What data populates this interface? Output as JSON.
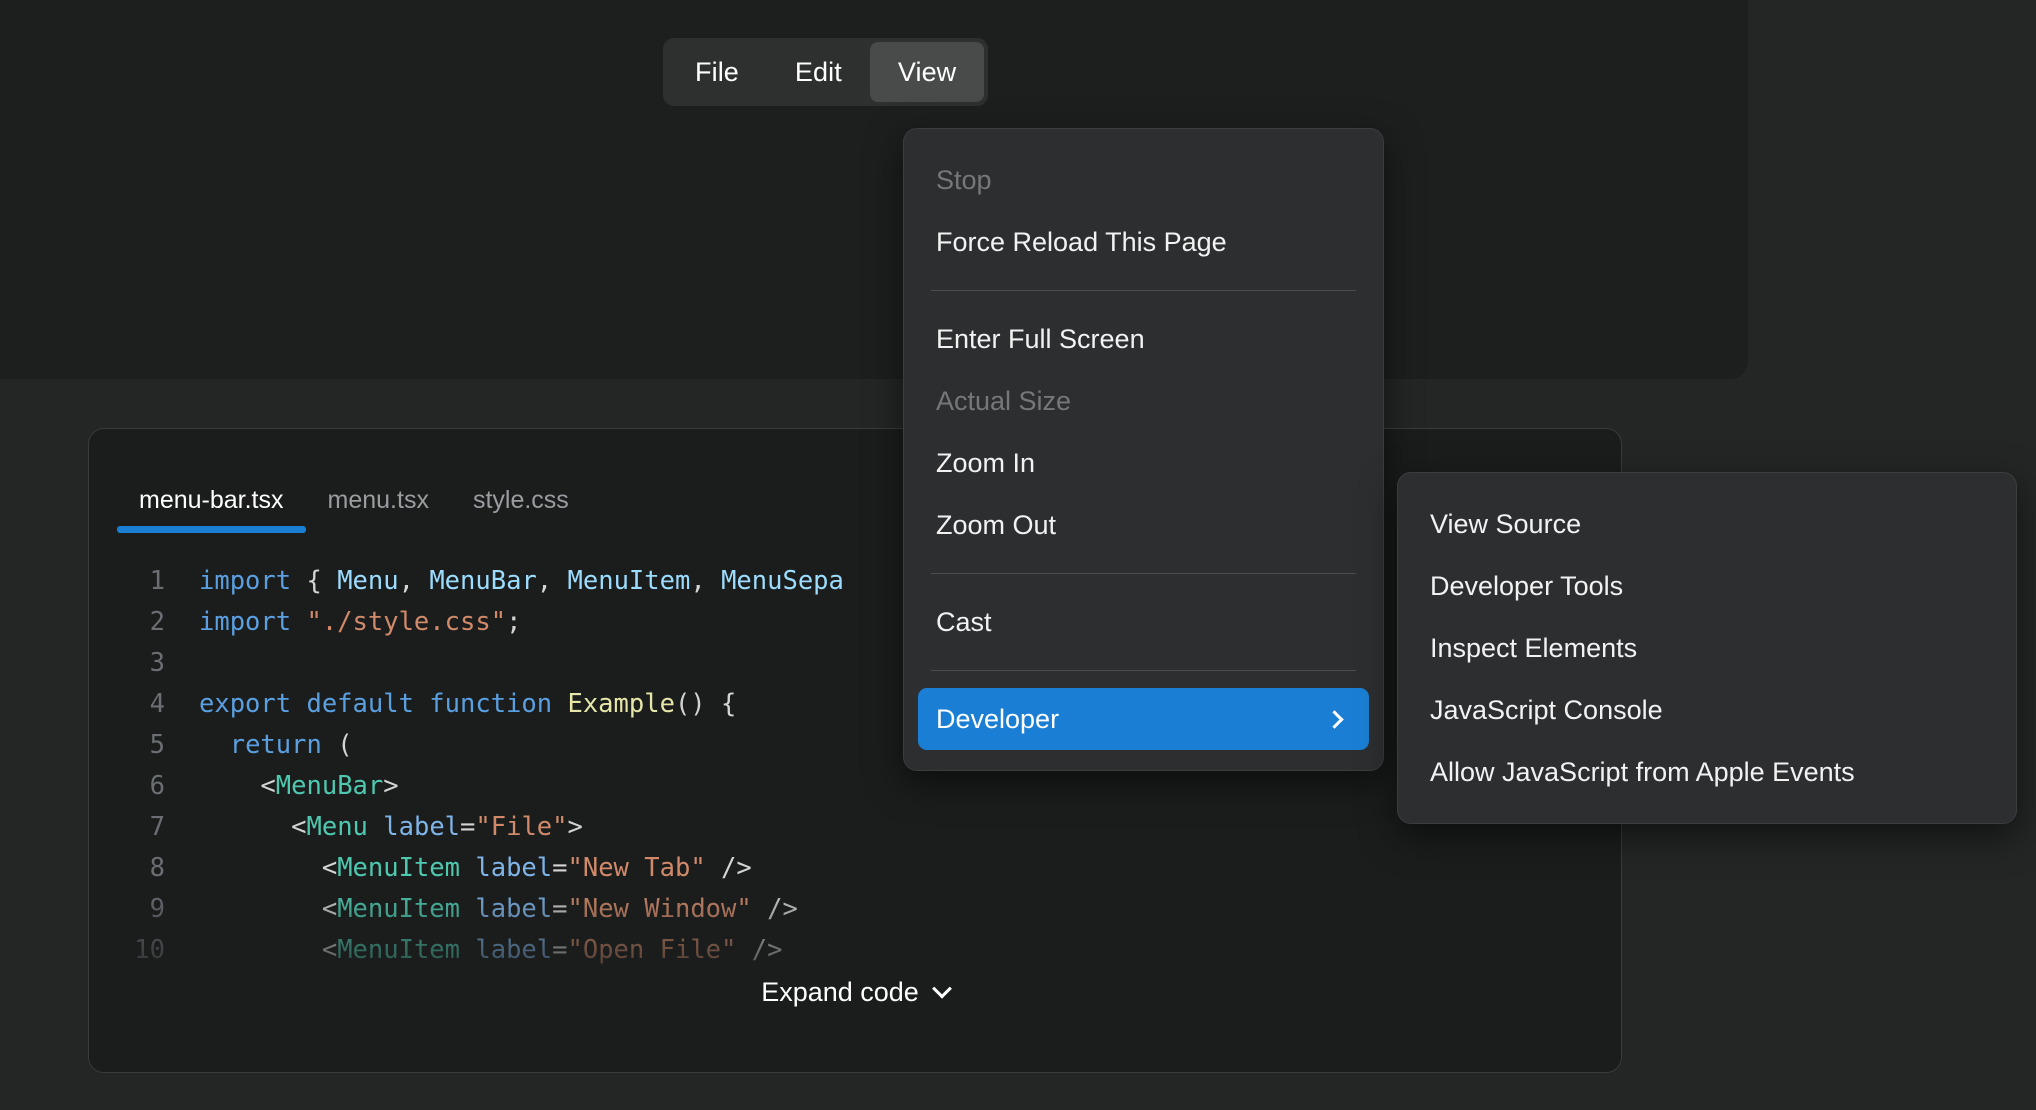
{
  "colors": {
    "page_background": "#242626",
    "demo_surface": "#1d1f1f",
    "menu_surface": "#2c2e30",
    "menubar_surface": "#2e3030",
    "menubar_active": "#494b4b",
    "accent_blue": "#1a7fd4",
    "code_panel": "#1b1d1d",
    "separator": "#4a4c4e",
    "text_primary": "#f2f2f2",
    "text_disabled": "#757779",
    "text_muted": "#9a9da0"
  },
  "menubar": {
    "items": [
      {
        "label": "File",
        "active": false
      },
      {
        "label": "Edit",
        "active": false
      },
      {
        "label": "View",
        "active": true
      }
    ]
  },
  "dropdown": {
    "groups": [
      {
        "items": [
          {
            "label": "Stop",
            "disabled": true,
            "highlighted": false,
            "submenu": false
          },
          {
            "label": "Force Reload This Page",
            "disabled": false,
            "highlighted": false,
            "submenu": false
          }
        ]
      },
      {
        "items": [
          {
            "label": "Enter Full Screen",
            "disabled": false,
            "highlighted": false,
            "submenu": false
          },
          {
            "label": "Actual Size",
            "disabled": true,
            "highlighted": false,
            "submenu": false
          },
          {
            "label": "Zoom In",
            "disabled": false,
            "highlighted": false,
            "submenu": false
          },
          {
            "label": "Zoom Out",
            "disabled": false,
            "highlighted": false,
            "submenu": false
          }
        ]
      },
      {
        "items": [
          {
            "label": "Cast",
            "disabled": false,
            "highlighted": false,
            "submenu": false
          }
        ]
      },
      {
        "items": [
          {
            "label": "Developer",
            "disabled": false,
            "highlighted": true,
            "submenu": true,
            "submenu_icon": "chevron-right-icon"
          }
        ]
      }
    ]
  },
  "submenu": {
    "parent": "Developer",
    "items": [
      {
        "label": "View Source"
      },
      {
        "label": "Developer Tools"
      },
      {
        "label": "Inspect Elements"
      },
      {
        "label": "JavaScript Console"
      },
      {
        "label": "Allow JavaScript from Apple Events"
      }
    ]
  },
  "code_panel": {
    "tabs": [
      {
        "label": "menu-bar.tsx",
        "active": true
      },
      {
        "label": "menu.tsx",
        "active": false
      },
      {
        "label": "style.css",
        "active": false
      }
    ],
    "lines": [
      {
        "number": "1",
        "tokens": [
          {
            "text": "import ",
            "type": "kw"
          },
          {
            "text": "{ ",
            "type": "punc"
          },
          {
            "text": "Menu",
            "type": "var"
          },
          {
            "text": ", ",
            "type": "punc"
          },
          {
            "text": "MenuBar",
            "type": "var"
          },
          {
            "text": ", ",
            "type": "punc"
          },
          {
            "text": "MenuItem",
            "type": "var"
          },
          {
            "text": ", ",
            "type": "punc"
          },
          {
            "text": "MenuSepa",
            "type": "var"
          }
        ]
      },
      {
        "number": "2",
        "tokens": [
          {
            "text": "import ",
            "type": "kw"
          },
          {
            "text": "\"./style.css\"",
            "type": "str"
          },
          {
            "text": ";",
            "type": "punc"
          }
        ]
      },
      {
        "number": "3",
        "tokens": []
      },
      {
        "number": "4",
        "tokens": [
          {
            "text": "export default function ",
            "type": "kw"
          },
          {
            "text": "Example",
            "type": "fn"
          },
          {
            "text": "() {",
            "type": "punc"
          }
        ]
      },
      {
        "number": "5",
        "tokens": [
          {
            "text": "  ",
            "type": "plain"
          },
          {
            "text": "return",
            "type": "kw"
          },
          {
            "text": " (",
            "type": "punc"
          }
        ]
      },
      {
        "number": "6",
        "tokens": [
          {
            "text": "    ",
            "type": "plain"
          },
          {
            "text": "<",
            "type": "punc"
          },
          {
            "text": "MenuBar",
            "type": "tag"
          },
          {
            "text": ">",
            "type": "punc"
          }
        ]
      },
      {
        "number": "7",
        "tokens": [
          {
            "text": "      ",
            "type": "plain"
          },
          {
            "text": "<",
            "type": "punc"
          },
          {
            "text": "Menu",
            "type": "tag"
          },
          {
            "text": " ",
            "type": "plain"
          },
          {
            "text": "label",
            "type": "attr"
          },
          {
            "text": "=",
            "type": "punc"
          },
          {
            "text": "\"File\"",
            "type": "str"
          },
          {
            "text": ">",
            "type": "punc"
          }
        ]
      },
      {
        "number": "8",
        "tokens": [
          {
            "text": "        ",
            "type": "plain"
          },
          {
            "text": "<",
            "type": "punc"
          },
          {
            "text": "MenuItem",
            "type": "tag"
          },
          {
            "text": " ",
            "type": "plain"
          },
          {
            "text": "label",
            "type": "attr"
          },
          {
            "text": "=",
            "type": "punc"
          },
          {
            "text": "\"New Tab\"",
            "type": "str"
          },
          {
            "text": " />",
            "type": "punc"
          }
        ]
      },
      {
        "number": "9",
        "tokens": [
          {
            "text": "        ",
            "type": "plain"
          },
          {
            "text": "<",
            "type": "punc"
          },
          {
            "text": "MenuItem",
            "type": "tag"
          },
          {
            "text": " ",
            "type": "plain"
          },
          {
            "text": "label",
            "type": "attr"
          },
          {
            "text": "=",
            "type": "punc"
          },
          {
            "text": "\"New Window\"",
            "type": "str"
          },
          {
            "text": " />",
            "type": "punc"
          }
        ]
      },
      {
        "number": "10",
        "tokens": [
          {
            "text": "        ",
            "type": "plain"
          },
          {
            "text": "<",
            "type": "punc"
          },
          {
            "text": "MenuItem",
            "type": "tag"
          },
          {
            "text": " ",
            "type": "plain"
          },
          {
            "text": "label",
            "type": "attr"
          },
          {
            "text": "=",
            "type": "punc"
          },
          {
            "text": "\"Open File\"",
            "type": "str"
          },
          {
            "text": " />",
            "type": "punc"
          }
        ]
      }
    ],
    "expand_label": "Expand code",
    "expand_icon": "chevron-down-icon"
  }
}
